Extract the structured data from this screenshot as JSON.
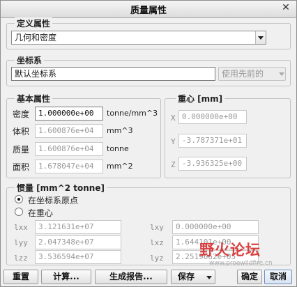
{
  "window": {
    "title": "质量属性",
    "close_glyph": "✕"
  },
  "definition": {
    "group_title": "定义属性",
    "selected": "几何和密度"
  },
  "coord_system": {
    "group_title": "坐标系",
    "value": "默认坐标系",
    "use_prev_label": "使用先前的"
  },
  "basic": {
    "group_title": "基本属性",
    "density_label": "密度",
    "density_value": "1.000000e+00",
    "density_unit": "tonne/mm^3",
    "volume_label": "体积",
    "volume_value": "1.600876e+04",
    "volume_unit": "mm^3",
    "mass_label": "质量",
    "mass_value": "1.600876e+04",
    "mass_unit": "tonne",
    "area_label": "面积",
    "area_value": "1.678047e+04",
    "area_unit": "mm^2"
  },
  "centroid": {
    "group_title": "重心 [mm]",
    "x_label": "X",
    "x_value": "0.000000e+00",
    "y_label": "Y",
    "y_value": "-3.787371e+01",
    "z_label": "Z",
    "z_value": "-3.936325e+00"
  },
  "inertia": {
    "group_title": "惯量 [mm^2 tonne]",
    "radio_origin": "在坐标系原点",
    "radio_center": "在重心",
    "lxx_label": "lxx",
    "lxx_value": "3.121631e+07",
    "lxy_label": "lxy",
    "lxy_value": "0.000000e+00",
    "lyy_label": "lyy",
    "lyy_value": "2.047348e+07",
    "lxz_label": "lxz",
    "lxz_value": "1.644101e+00",
    "lzz_label": "lzz",
    "lzz_value": "3.536594e+07",
    "lyz_label": "lyz",
    "lyz_value": "2.2519662e+05"
  },
  "footer": {
    "reset": "重置",
    "compute": "计算...",
    "report": "生成报告...",
    "save": "保存",
    "ok": "确定",
    "cancel": "取消"
  },
  "watermark": {
    "text": "野火论坛",
    "sub": "www.proewildfire.cn"
  }
}
